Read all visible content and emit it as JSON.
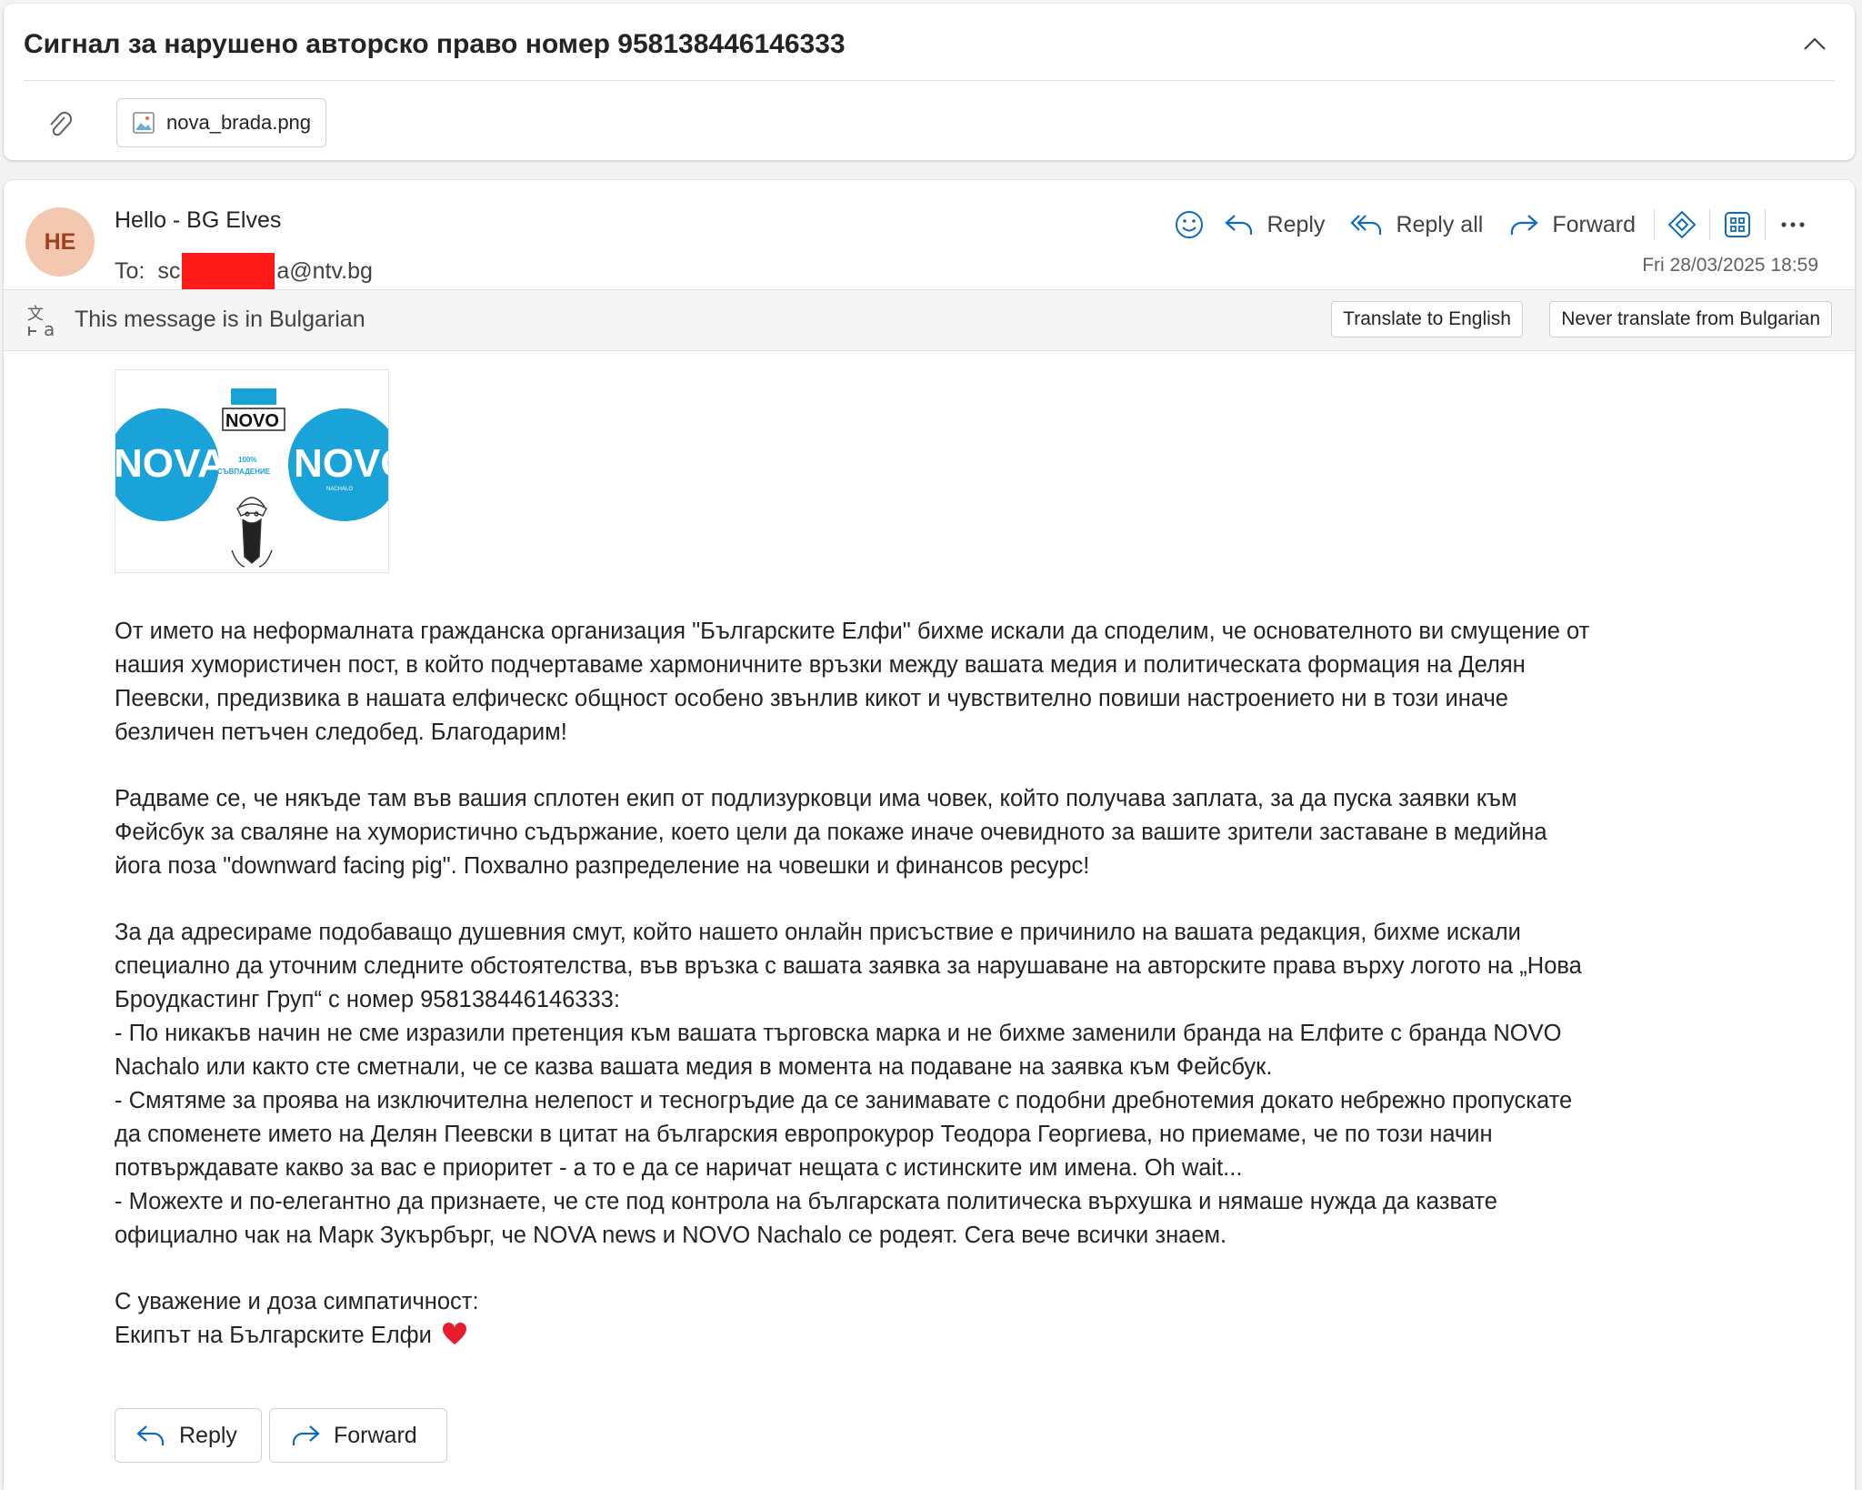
{
  "subject": "Сигнал за нарушено авторско право номер 958138446146333",
  "attachment": {
    "filename": "nova_brada.png"
  },
  "sender": {
    "initials": "HE",
    "name": "Hello - BG Elves"
  },
  "recipient": {
    "label": "To:",
    "prefix": "sc",
    "suffix": "a@ntv.bg"
  },
  "actions": {
    "reply": "Reply",
    "reply_all": "Reply all",
    "forward": "Forward"
  },
  "date": "Fri 28/03/2025 18:59",
  "translate_bar": {
    "message": "This message is in Bulgarian",
    "translate_button": "Translate to English",
    "never_button": "Never translate from Bulgarian"
  },
  "logo_image": {
    "top_text": "NOVO",
    "left_text": "NOVA",
    "right_text": "NOVO",
    "right_subtext": "NACHALO",
    "center_percent": "100%",
    "center_label": "СЪВПАДЕНИЕ"
  },
  "body": {
    "p1": [
      "От името на неформалната гражданска организация \"Българските Елфи\" бихме искали да споделим, че основателното ви смущение от",
      "нашия хумористичен пост, в който подчертаваме хармоничните връзки между вашата медия и политическата формация на Делян",
      "Пеевски, предизвика в нашата елфическс общност особено звънлив кикот и чувствително повиши настроението ни в този иначе",
      "безличен петъчен следобед. Благодарим!"
    ],
    "p2": [
      "Радваме се, че някъде там във вашия сплотен екип от подлизурковци има човек, който получава заплата, за да пуска заявки към",
      "Фейсбук за сваляне на хумористично съдържание, което цели да покаже иначе очевидното за вашите зрители заставане в медийна",
      "йога поза \"downward facing pig\". Похвално разпределение на човешки и финансов ресурс!"
    ],
    "p3": [
      "За да адресираме подобаващо душевния смут, който нашето онлайн присъствие е причинило на вашата редакция, бихме искали",
      "специално да уточним следните обстоятелства, във връзка с вашата заявка за нарушаване на авторските права върху логото на „Нова",
      "Броудкастинг Груп“ с номер 958138446146333:",
      "- По никакъв начин не сме изразили претенция към вашата търговска марка и не бихме заменили бранда на Елфите с бранда NOVO",
      "Nachalo или както сте сметнали, че се казва вашата медия в момента на подаване на заявка към Фейсбук.",
      "- Смятяме за проява на изключителна нелепост и тесногръдие да се занимавате с подобни дребнотемия докато небрежно пропускате",
      "да споменете името на Делян Пеевски в цитат на българския европрокурор Теодора Георгиева, но приемаме, че по този начин",
      "потвърждавате какво за вас е приоритет - а то е да се наричат нещата с истинските им имена. Oh wait...",
      "- Можехте и по-елегантно да признаете, че сте под контрола на българската политическа върхушка и нямаше нужда да казвате",
      "официално чак на Марк Зукърбърг, че NOVA news и NOVO Nachalo се родеят. Сега вече всички знаем."
    ],
    "signoff": "С уважение и доза симпатичност:",
    "signature": "Екипът на Българските Елфи"
  },
  "footer": {
    "reply": "Reply",
    "forward": "Forward"
  },
  "colors": {
    "accent": "#0f6cbd",
    "avatar_bg": "#f4c7b0",
    "avatar_text": "#a2401d",
    "redaction": "#ff1a1a",
    "logo_blue": "#1aa3d9",
    "heart": "#e81c2c"
  }
}
